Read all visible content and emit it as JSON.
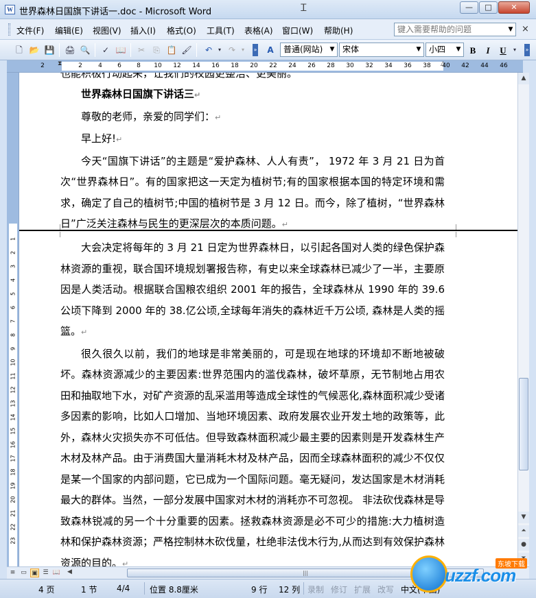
{
  "window": {
    "title": "世界森林日国旗下讲话一.doc - Microsoft Word",
    "app_icon": "W",
    "minimize": "—",
    "maximize": "□",
    "close": "✕"
  },
  "menu": {
    "items": [
      "文件(F)",
      "编辑(E)",
      "视图(V)",
      "插入(I)",
      "格式(O)",
      "工具(T)",
      "表格(A)",
      "窗口(W)",
      "帮助(H)"
    ],
    "help_placeholder": "键入需要帮助的问题",
    "close_doc": "×"
  },
  "toolbar": {
    "style": "普通(网站)",
    "font": "宋体",
    "size": "小四",
    "bold": "B",
    "italic": "I",
    "underline": "U"
  },
  "ruler": {
    "ticks": [
      "2",
      "2",
      "4",
      "6",
      "8",
      "10",
      "12",
      "14",
      "16",
      "18",
      "20",
      "22",
      "24",
      "26",
      "28",
      "30",
      "32",
      "34",
      "36",
      "38",
      "40",
      "42",
      "44",
      "46"
    ]
  },
  "vruler": {
    "ticks": [
      "1",
      "2",
      "3",
      "4",
      "5",
      "6",
      "7",
      "8",
      "9",
      "10",
      "11",
      "12",
      "13",
      "14",
      "15",
      "16",
      "17",
      "18",
      "19",
      "20",
      "21",
      "22",
      "23"
    ]
  },
  "document": {
    "cut_line": "也能积极行动起来，让我们的校园更整洁、更美丽。",
    "title": "世界森林日国旗下讲话三",
    "greeting": "尊敬的老师，亲爱的同学们：",
    "morning": "早上好!",
    "p1": "今天“国旗下讲话”的主题是“爱护森林、人人有责”， 1972 年 3 月 21 日为首次“世界森林日”。有的国家把这一天定为植树节;有的国家根据本国的特定环境和需求，确定了自己的植树节;中国的植树节是 3 月 12 日。而今，除了植树，“世界森林日”广泛关注森林与民生的更深层次的本质问题。",
    "p2": "大会决定将每年的 3 月 21 日定为世界森林日，以引起各国对人类的绿色保护森林资源的重视，联合国环境规划署报告称，有史以来全球森林已减少了一半，主要原因是人类活动。根据联合国粮农组织 2001 年的报告，全球森林从 1990 年的 39.6 公顷下降到 2000 年的 38.亿公顷,全球每年消失的森林近千万公顷, 森林是人类的摇篮。",
    "p3": "很久很久以前，我们的地球是非常美丽的，可是现在地球的环境却不断地被破坏。森林资源减少的主要因素:世界范围内的滥伐森林，破坏草原，无节制地占用农田和抽取地下水，对矿产资源的乱采滥用等造成全球性的气候恶化,森林面积减少受诸多因素的影响，比如人口增加、当地环境因素、政府发展农业开发土地的政策等，此外，森林火灾损失亦不可低估。但导致森林面积减少最主要的因素则是开发森林生产木材及林产品。由于消费国大量消耗木材及林产品，因而全球森林面积的减少不仅仅是某一个国家的内部问题，它已成为一个国际问题。毫无疑问，发达国家是木材消耗最大的群体。当然，一部分发展中国家对木材的消耗亦不可忽视。 非法砍伐森林是导致森林锐减的另一个十分重要的因素。拯救森林资源是必不可少的措施:大力植树造林和保护森林资源；严格控制林木砍伐量，杜绝非法伐木行为,从而达到有效保护森林资源的目的。",
    "para_mark": "↵"
  },
  "status": {
    "page": "4 页",
    "section": "1 节",
    "page_of": "4/4",
    "position": "位置 8.8厘米",
    "line": "9 行",
    "column": "12 列",
    "rec": "录制",
    "trk": "修订",
    "ext": "扩展",
    "ovr": "改写",
    "lang": "中文(中国)"
  },
  "watermark": {
    "brand": "uzzf.com",
    "tag": "东坡下载"
  }
}
